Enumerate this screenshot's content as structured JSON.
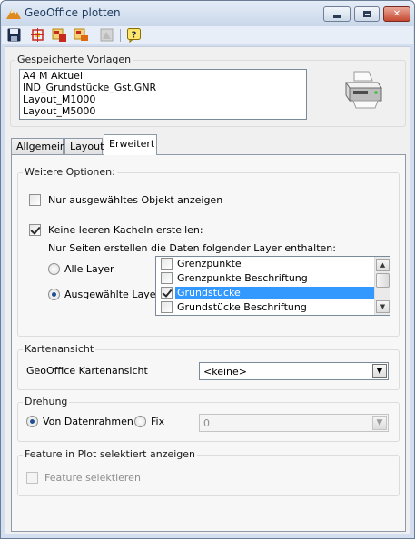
{
  "window": {
    "title": "GeoOffice plotten",
    "minimize_symbol": "",
    "maximize_symbol": "",
    "close_symbol": "✕"
  },
  "toolbar": {
    "icons": [
      "save-icon",
      "select-frame-icon",
      "layout-add-icon",
      "layout-remove-icon",
      "disabled-tool-icon",
      "help-icon"
    ]
  },
  "templates": {
    "label": "Gespeicherte Vorlagen",
    "items": [
      "A4 M Aktuell",
      "IND_Grundstücke_Gst.GNR",
      "Layout_M1000",
      "Layout_M5000"
    ]
  },
  "tabs": [
    {
      "label": "Allgemein",
      "active": false
    },
    {
      "label": "Layout",
      "active": false
    },
    {
      "label": "Erweitert",
      "active": true
    }
  ],
  "weitere_optionen": {
    "label": "Weitere Optionen:",
    "only_selected_object": {
      "label": "Nur ausgewähltes Objekt anzeigen",
      "checked": false
    },
    "no_empty_tiles": {
      "label": "Keine leeren Kacheln erstellen:",
      "checked": true
    },
    "pages_hint": "Nur Seiten erstellen die Daten folgender Layer enthalten:",
    "radio_all": {
      "label": "Alle Layer",
      "checked": false
    },
    "radio_selected": {
      "label": "Ausgewählte Layer",
      "checked": true
    },
    "layers": [
      {
        "label": "Grenzpunkte",
        "checked": false,
        "selected": false
      },
      {
        "label": "Grenzpunkte Beschriftung",
        "checked": false,
        "selected": false
      },
      {
        "label": "Grundstücke",
        "checked": true,
        "selected": true
      },
      {
        "label": "Grundstücke Beschriftung",
        "checked": false,
        "selected": false
      }
    ],
    "scroll_up": "▲",
    "scroll_down": "▼"
  },
  "kartenansicht": {
    "label": "Kartenansicht",
    "field_label": "GeoOffice Kartenansicht",
    "value": "<keine>",
    "arrow": "▼"
  },
  "drehung": {
    "label": "Drehung",
    "radio_frame": {
      "label": "Von Datenrahmen",
      "checked": true
    },
    "radio_fixed": {
      "label": "Fix",
      "checked": false
    },
    "fixed_value": "0",
    "arrow": "▼"
  },
  "feature": {
    "label": "Feature in Plot selektiert anzeigen",
    "checkbox": {
      "label": "Feature selektieren",
      "checked": false
    }
  },
  "colors": {
    "selection": "#3399ff",
    "title_text": "#1e3b5e",
    "window_frame": "#d3dff0"
  }
}
